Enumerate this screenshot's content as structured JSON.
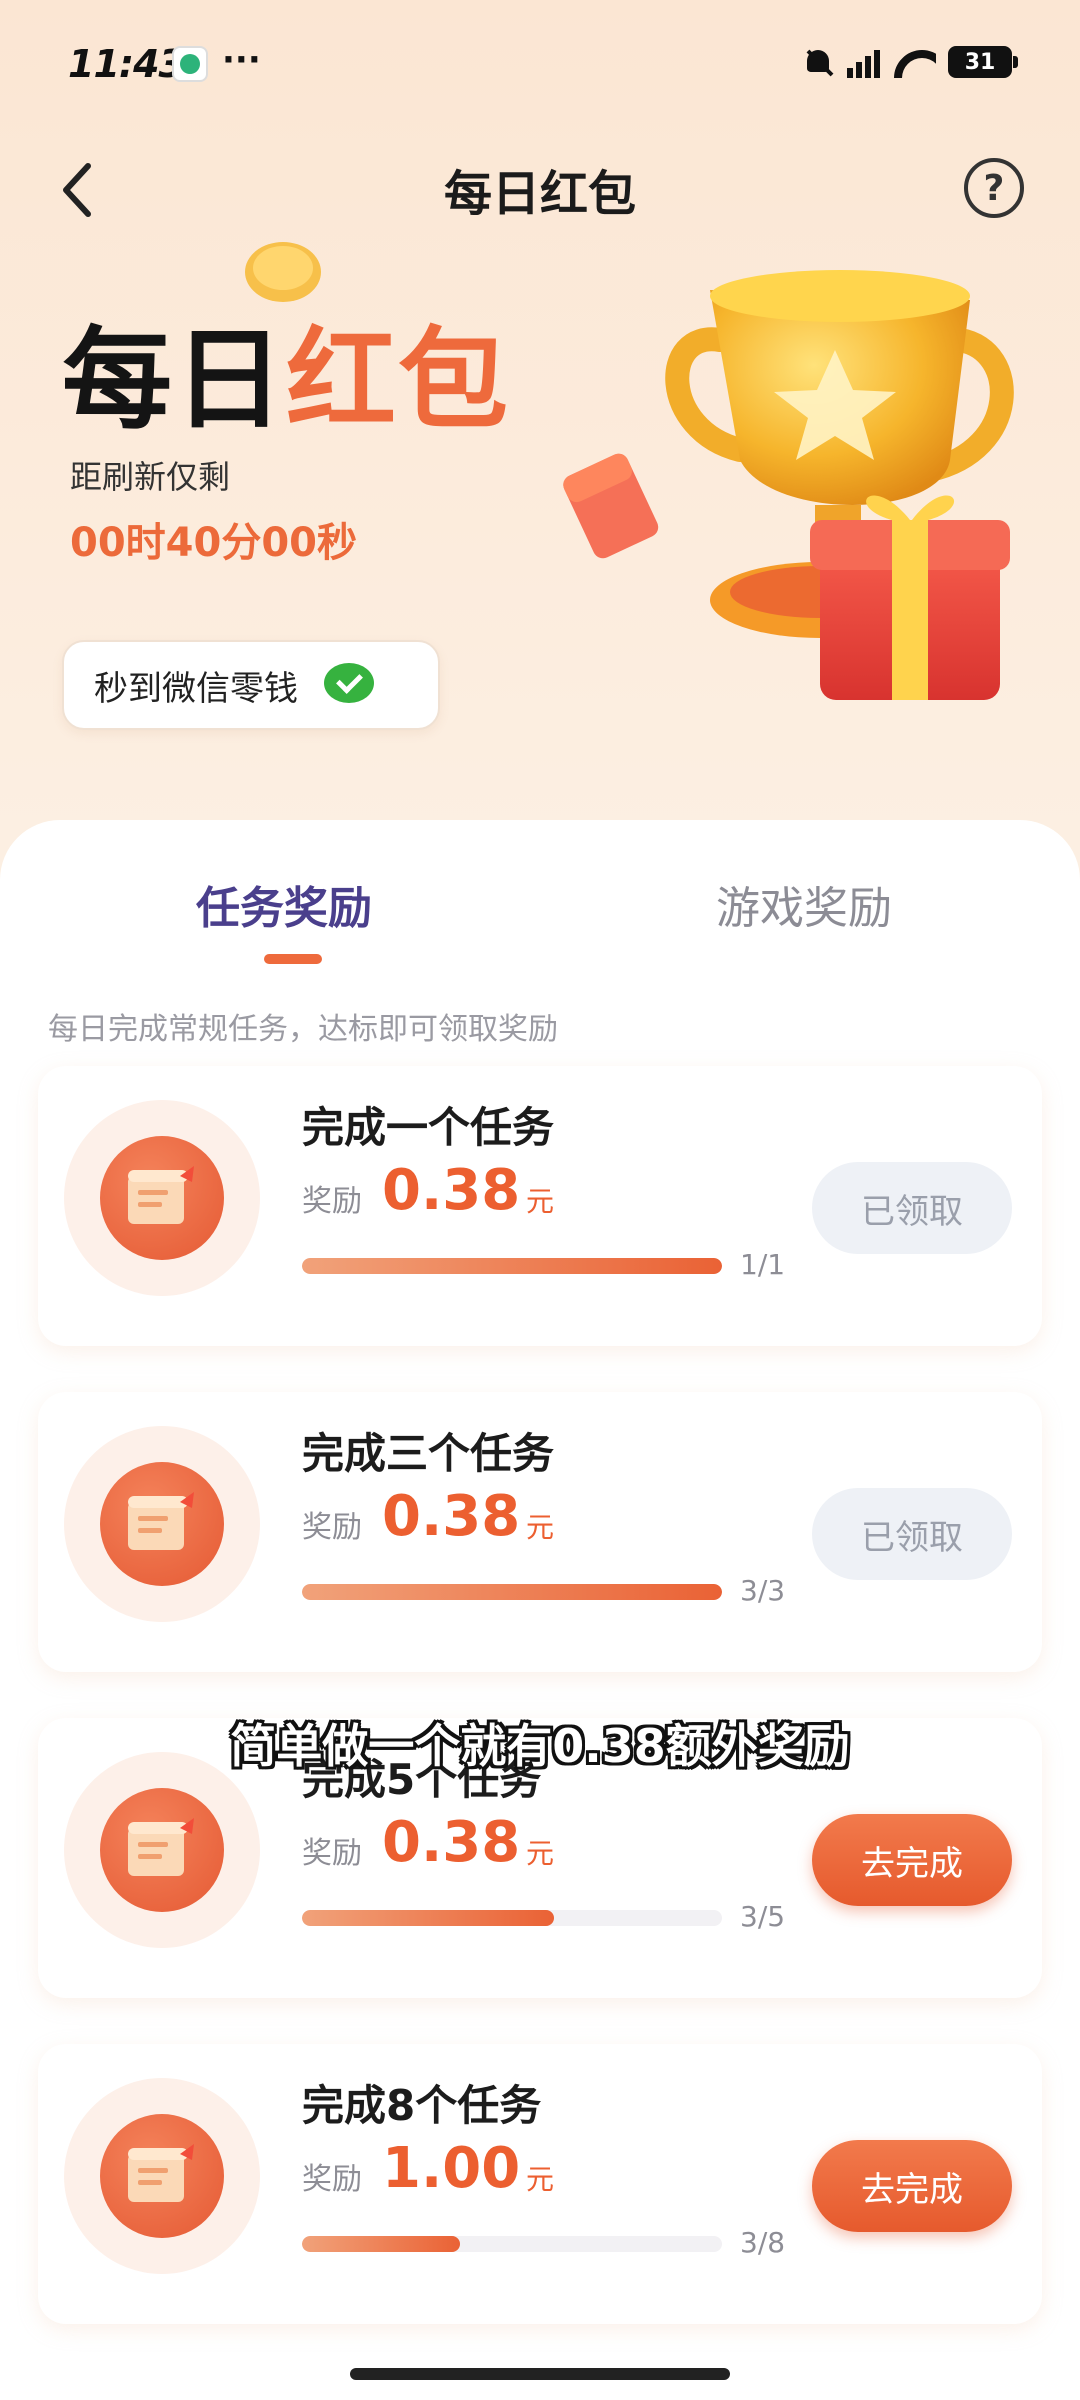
{
  "status_bar": {
    "time": "11:43",
    "dots": "···",
    "battery": "31"
  },
  "header": {
    "title": "每日红包",
    "help": "?"
  },
  "hero": {
    "title_part1": "每日",
    "title_part2": "红包",
    "refresh_label": "距刷新仅剩",
    "countdown": "00时40分00秒",
    "wechat_chip": "秒到微信零钱"
  },
  "tabs": [
    {
      "label": "任务奖励",
      "active": true
    },
    {
      "label": "游戏奖励",
      "active": false
    }
  ],
  "subtitle": "每日完成常规任务，达标即可领取奖励",
  "reward_label": "奖励",
  "reward_unit": "元",
  "tasks": [
    {
      "name": "完成一个任务",
      "amount": "0.38",
      "progress": "1/1",
      "fraction": 1.0,
      "button": "已领取",
      "state": "claimed"
    },
    {
      "name": "完成三个任务",
      "amount": "0.38",
      "progress": "3/3",
      "fraction": 1.0,
      "button": "已领取",
      "state": "claimed"
    },
    {
      "name": "完成5个任务",
      "amount": "0.38",
      "progress": "3/5",
      "fraction": 0.6,
      "button": "去完成",
      "state": "go"
    },
    {
      "name": "完成8个任务",
      "amount": "1.00",
      "progress": "3/8",
      "fraction": 0.375,
      "button": "去完成",
      "state": "go"
    }
  ],
  "caption": "简单做一个就有0.38额外奖励",
  "colors": {
    "accent": "#ec5f30",
    "tab_active": "#4a3f8c",
    "claimed_bg": "#eef1f6"
  }
}
